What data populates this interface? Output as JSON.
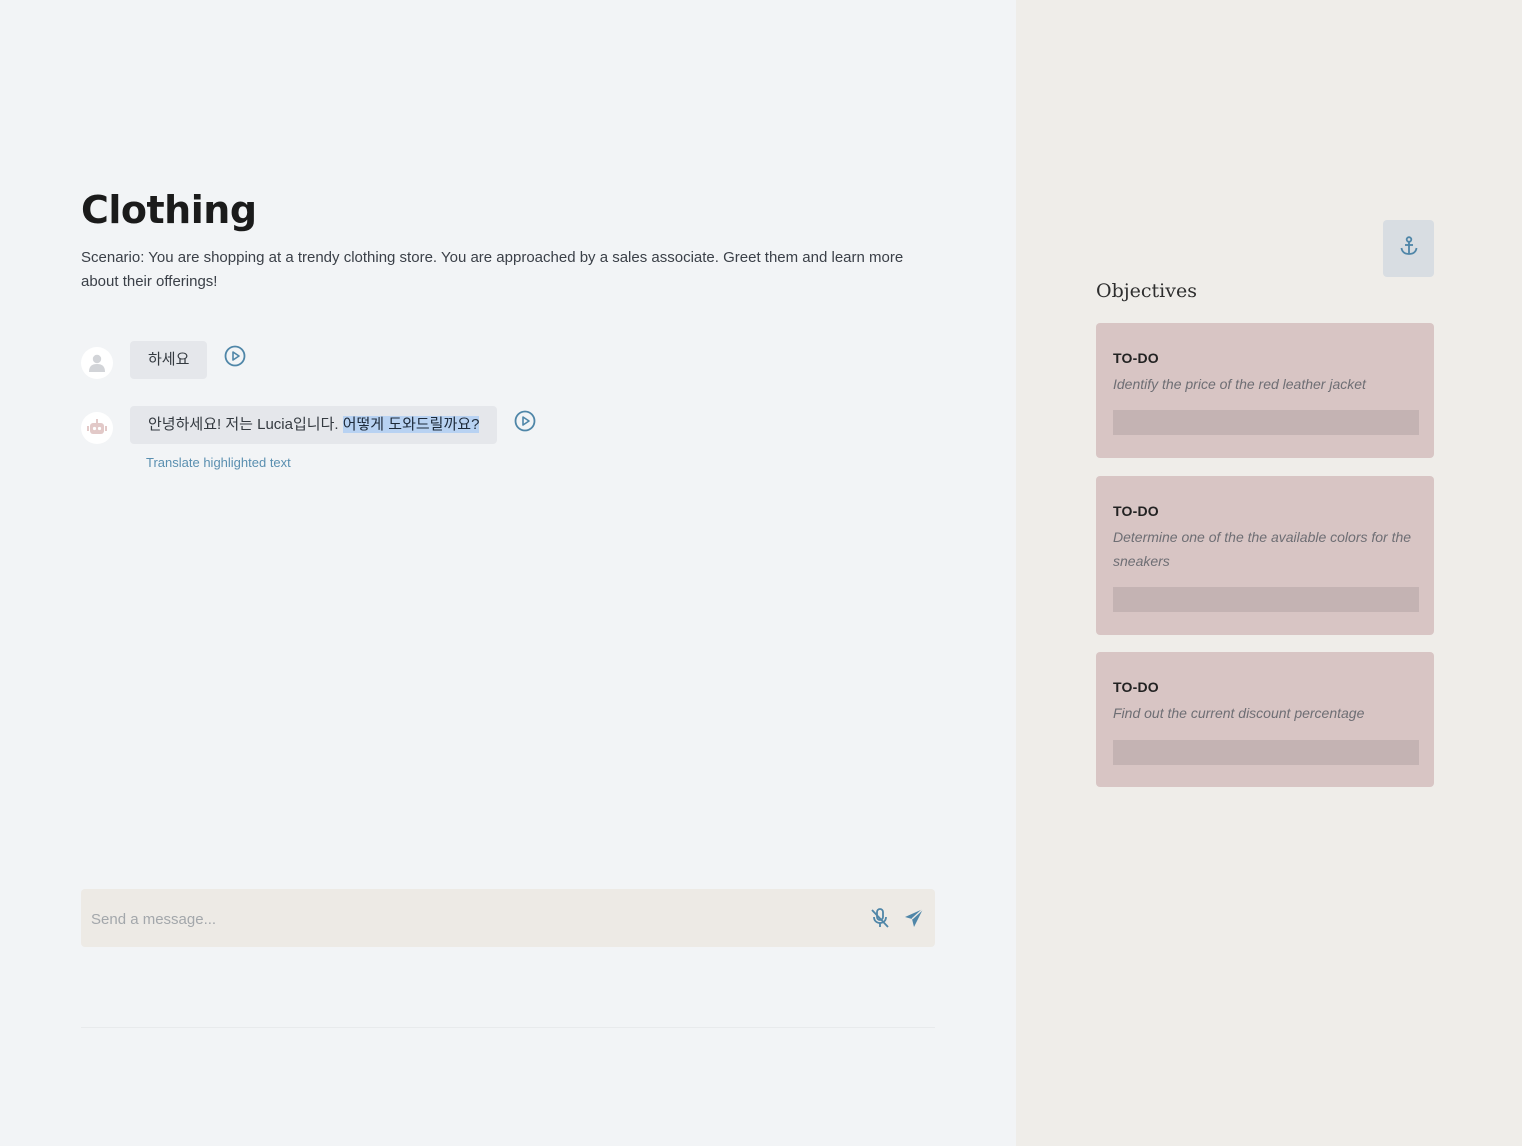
{
  "chat": {
    "title": "Clothing",
    "scenario": "Scenario: You are shopping at a trendy clothing store. You are approached by a sales associate. Greet them and learn more about their offerings!",
    "messages": [
      {
        "role": "user",
        "text": "하세요"
      },
      {
        "role": "assistant",
        "text_plain": "안녕하세요! 저는 Lucia입니다. ",
        "text_highlighted": "어떻게 도와드릴까요?"
      }
    ],
    "translate_link": "Translate highlighted text",
    "input_placeholder": "Send a message..."
  },
  "objectives": {
    "heading": "Objectives",
    "items": [
      {
        "status": "TO-DO",
        "text": "Identify the price of the red leather jacket"
      },
      {
        "status": "TO-DO",
        "text": "Determine one of the the available colors for the sneakers"
      },
      {
        "status": "TO-DO",
        "text": "Find out the current discount percentage"
      }
    ]
  },
  "icons": {
    "user_avatar": "user-icon",
    "assistant_avatar": "robot-icon",
    "play": "play-circle-icon",
    "mic": "microphone-off-icon",
    "send": "send-icon",
    "anchor": "anchor-icon"
  },
  "colors": {
    "accent": "#4f86a8",
    "objective_card": "#d8c5c4",
    "highlight": "#b8d2f2"
  }
}
